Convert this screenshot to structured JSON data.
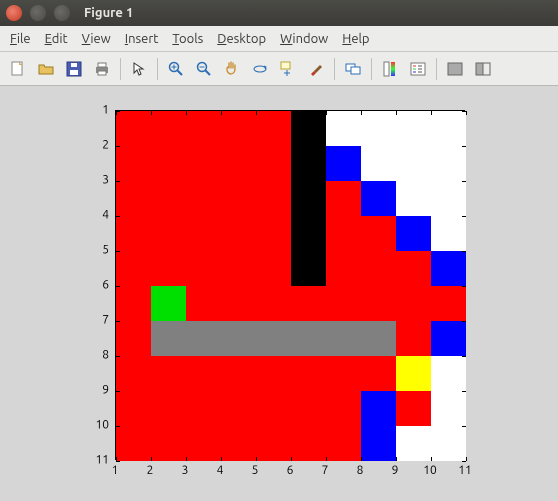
{
  "window": {
    "title": "Figure 1"
  },
  "menus": [
    "File",
    "Edit",
    "View",
    "Insert",
    "Tools",
    "Desktop",
    "Window",
    "Help"
  ],
  "toolbar_icons": [
    "new-figure-icon",
    "open-file-icon",
    "save-icon",
    "print-icon",
    "sep",
    "pointer-icon",
    "sep",
    "zoom-in-icon",
    "zoom-out-icon",
    "pan-icon",
    "rotate-3d-icon",
    "data-cursor-icon",
    "brush-icon",
    "sep",
    "link-plot-icon",
    "sep",
    "colorbar-icon",
    "legend-icon",
    "sep",
    "hide-tools-icon",
    "dock-icon"
  ],
  "axis": {
    "x_ticks": [
      1,
      2,
      3,
      4,
      5,
      6,
      7,
      8,
      9,
      10,
      11
    ],
    "y_ticks": [
      1,
      2,
      3,
      4,
      5,
      6,
      7,
      8,
      9,
      10,
      11
    ],
    "x_range": [
      1,
      11
    ],
    "y_range": [
      1,
      11
    ],
    "y_reversed": true
  },
  "chart_data": {
    "type": "heatmap",
    "title": "",
    "xlabel": "",
    "ylabel": "",
    "x_range": [
      1,
      11
    ],
    "y_range": [
      1,
      11
    ],
    "grid_size": [
      10,
      10
    ],
    "color_legend": {
      "0": "#ffffff",
      "1": "#ff0000",
      "2": "#000000",
      "3": "#0000ff",
      "4": "#00e000",
      "5": "#808080",
      "6": "#ffff00"
    },
    "cells": [
      [
        1,
        1,
        1,
        1,
        1,
        2,
        0,
        0,
        0,
        0
      ],
      [
        1,
        1,
        1,
        1,
        1,
        2,
        3,
        0,
        0,
        0
      ],
      [
        1,
        1,
        1,
        1,
        1,
        2,
        1,
        3,
        0,
        0
      ],
      [
        1,
        1,
        1,
        1,
        1,
        2,
        1,
        1,
        3,
        0
      ],
      [
        1,
        1,
        1,
        1,
        1,
        2,
        1,
        1,
        1,
        3
      ],
      [
        1,
        4,
        1,
        1,
        1,
        1,
        1,
        1,
        1,
        1
      ],
      [
        1,
        5,
        5,
        5,
        5,
        5,
        5,
        5,
        1,
        3
      ],
      [
        1,
        1,
        1,
        1,
        1,
        1,
        1,
        1,
        6,
        0
      ],
      [
        1,
        1,
        1,
        1,
        1,
        1,
        1,
        3,
        1,
        0
      ],
      [
        1,
        1,
        1,
        1,
        1,
        1,
        1,
        3,
        0,
        0
      ]
    ]
  }
}
